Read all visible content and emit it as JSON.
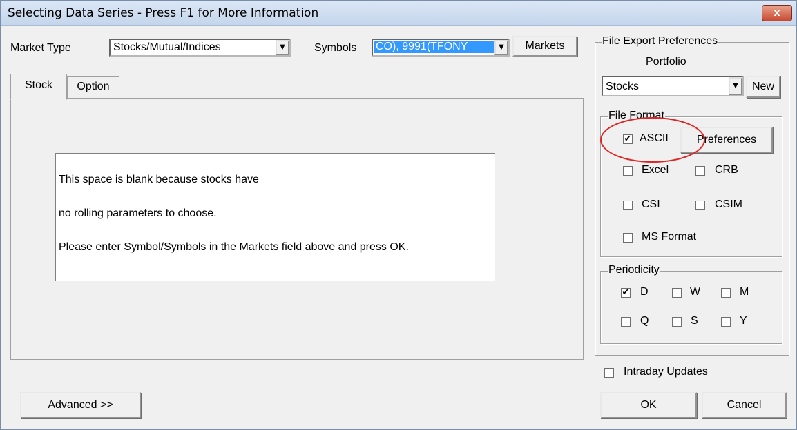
{
  "window": {
    "title": "Selecting Data Series - Press F1 for More Information",
    "close_glyph": "x"
  },
  "market": {
    "label": "Market Type",
    "value": "Stocks/Mutual/Indices"
  },
  "symbols": {
    "label": "Symbols",
    "value": "CO), 9991(TFONY",
    "markets_button": "Markets"
  },
  "tabs": [
    {
      "label": "Stock",
      "selected": true
    },
    {
      "label": "Option",
      "selected": false
    }
  ],
  "message": {
    "line1": "This space is blank because stocks have",
    "line2": "no rolling parameters to choose.",
    "line3": "Please enter Symbol/Symbols in the Markets field above and press OK."
  },
  "export": {
    "group_label": "File Export Preferences",
    "portfolio_label": "Portfolio",
    "portfolio_value": "Stocks",
    "new_button": "New"
  },
  "file_format": {
    "group_label": "File Format",
    "ascii": {
      "label": "ASCII",
      "checked": true
    },
    "preferences_button": "Preferences",
    "excel": {
      "label": "Excel",
      "checked": false
    },
    "crb": {
      "label": "CRB",
      "checked": false
    },
    "csi": {
      "label": "CSI",
      "checked": false
    },
    "csim": {
      "label": "CSIM",
      "checked": false
    },
    "ms": {
      "label": "MS Format",
      "checked": false
    }
  },
  "periodicity": {
    "group_label": "Periodicity",
    "d": {
      "label": "D",
      "checked": true
    },
    "w": {
      "label": "W",
      "checked": false
    },
    "m": {
      "label": "M",
      "checked": false
    },
    "q": {
      "label": "Q",
      "checked": false
    },
    "s": {
      "label": "S",
      "checked": false
    },
    "y": {
      "label": "Y",
      "checked": false
    }
  },
  "intraday": {
    "label": "Intraday Updates",
    "checked": false
  },
  "buttons": {
    "advanced": "Advanced >>",
    "ok": "OK",
    "cancel": "Cancel"
  },
  "colors": {
    "selection": "#3399ff",
    "annotation_circle": "#e02424"
  },
  "icons": {
    "check": "✔",
    "dropdown": "▼"
  }
}
